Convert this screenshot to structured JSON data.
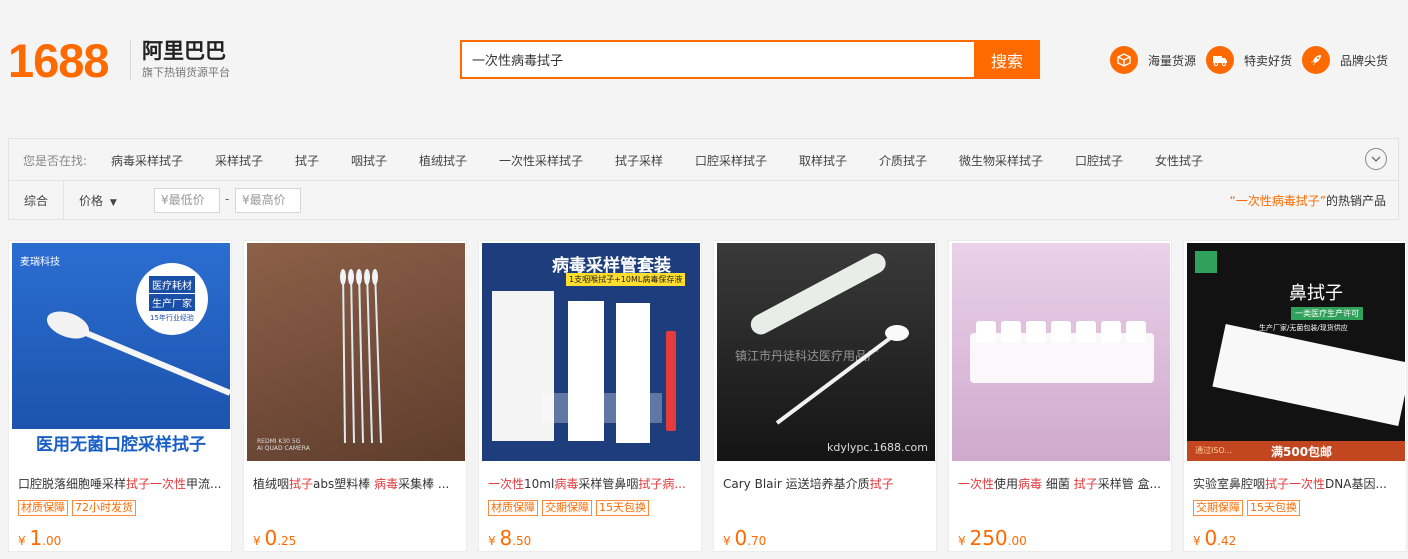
{
  "header": {
    "logo_number": "1688",
    "logo_cn": "阿里巴巴",
    "logo_sub": "旗下热销货源平台",
    "search_value": "一次性病毒拭子",
    "search_button": "搜索",
    "features": [
      {
        "label": "海量货源",
        "icon": "box-icon"
      },
      {
        "label": "特卖好货",
        "icon": "truck-icon"
      },
      {
        "label": "品牌尖货",
        "icon": "rocket-icon"
      }
    ]
  },
  "suggest": {
    "lead": "您是否在找:",
    "items": [
      "病毒采样拭子",
      "采样拭子",
      "拭子",
      "咽拭子",
      "植绒拭子",
      "一次性采样拭子",
      "拭子采样",
      "口腔采样拭子",
      "取样拭子",
      "介质拭子",
      "微生物采样拭子",
      "口腔拭子",
      "女性拭子"
    ]
  },
  "filter": {
    "sort_all": "综合",
    "price": "价格",
    "min_placeholder": "¥最低价",
    "max_placeholder": "¥最高价",
    "dash": "-",
    "hot_keyword": "“一次性病毒拭子”",
    "hot_suffix": "的热销产品"
  },
  "products": [
    {
      "title_parts": [
        [
          "口腔脱落细胞唾采样",
          false
        ],
        [
          "拭子",
          true
        ],
        [
          "一次性",
          true
        ],
        [
          "甲流...",
          false
        ]
      ],
      "tags": [
        "材质保障",
        "72小时发货"
      ],
      "price_int": "1",
      "price_dec": ".00",
      "img_text": [
        "麦瑞科技",
        "医疗耗材",
        "生产厂家",
        "15年行业经验",
        "医用无菌口腔采样拭子"
      ]
    },
    {
      "title_parts": [
        [
          "植绒咽",
          false
        ],
        [
          "拭子",
          true
        ],
        [
          "abs塑料棒 ",
          false
        ],
        [
          "病毒",
          true
        ],
        [
          "采集棒 ...",
          false
        ]
      ],
      "tags": [],
      "price_int": "0",
      "price_dec": ".25",
      "img_text": [
        "REDMI K30 5G",
        "AI QUAD CAMERA"
      ]
    },
    {
      "title_parts": [
        [
          "一次性",
          true
        ],
        [
          "10ml",
          false
        ],
        [
          "病毒",
          true
        ],
        [
          "采样管鼻咽",
          false
        ],
        [
          "拭子病...",
          true
        ]
      ],
      "tags": [
        "材质保障",
        "交期保障",
        "15天包换"
      ],
      "price_int": "8",
      "price_dec": ".50",
      "img_text": [
        "病毒采样管套装",
        "1支咽喉拭子+10ML病毒保存液"
      ]
    },
    {
      "title_parts": [
        [
          "Cary Blair 运送培养基介质",
          false
        ],
        [
          "拭子",
          true
        ]
      ],
      "tags": [],
      "price_int": "0",
      "price_dec": ".70",
      "img_text": [
        "镇江市丹徒科达医疗用品厂",
        "kdylypc.1688.com"
      ]
    },
    {
      "title_parts": [
        [
          "一次性",
          true
        ],
        [
          "使用",
          false
        ],
        [
          "病毒",
          true
        ],
        [
          " 细菌 ",
          false
        ],
        [
          "拭子",
          true
        ],
        [
          "采样管 盒...",
          false
        ]
      ],
      "tags": [],
      "price_int": "250",
      "price_dec": ".00",
      "img_text": []
    },
    {
      "title_parts": [
        [
          "实验室鼻腔咽",
          false
        ],
        [
          "拭子",
          true
        ],
        [
          "一次性",
          true
        ],
        [
          "DNA基因...",
          false
        ]
      ],
      "tags": [
        "交期保障",
        "15天包换"
      ],
      "price_int": "0",
      "price_dec": ".42",
      "img_text": [
        "鼻拭子",
        "一类医疗生产许可",
        "生产厂家/无菌包装/现货供应",
        "通过ISO...",
        "满500包邮"
      ]
    }
  ],
  "currency": "¥",
  "colors": {
    "brand": "#ff6a00",
    "highlight": "#e4393c"
  }
}
